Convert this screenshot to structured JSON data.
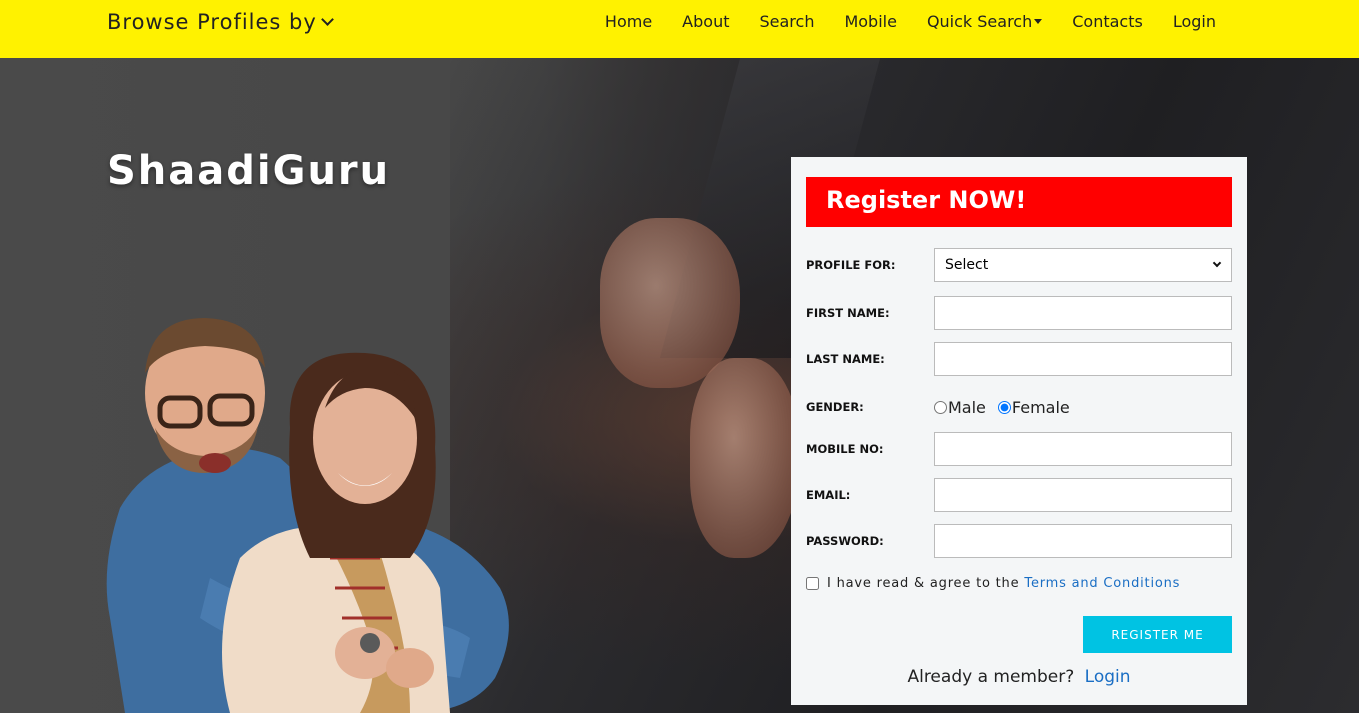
{
  "navbar": {
    "browse_label": "Browse Profiles by",
    "items": [
      {
        "label": "Home"
      },
      {
        "label": "About"
      },
      {
        "label": "Search"
      },
      {
        "label": "Mobile"
      },
      {
        "label": "Quick Search"
      },
      {
        "label": "Contacts"
      },
      {
        "label": "Login"
      }
    ]
  },
  "hero": {
    "brand": "ShaadiGuru"
  },
  "form": {
    "heading": "Register NOW!",
    "profile_for_label": "PROFILE FOR:",
    "profile_for_value": "Select",
    "first_name_label": "FIRST NAME:",
    "last_name_label": "LAST NAME:",
    "gender_label": "GENDER:",
    "gender_male": "Male",
    "gender_female": "Female",
    "gender_selected": "Female",
    "mobile_label": "MOBILE NO:",
    "email_label": "EMAIL:",
    "password_label": "PASSWORD:",
    "agree_text": "I have read & agree to the",
    "terms_link": "Terms and Conditions",
    "submit_label": "REGISTER ME",
    "already_text": "Already a member?",
    "login_link": "Login"
  },
  "colors": {
    "navbar_bg": "#fff200",
    "heading_bg": "#ff0000",
    "button_bg": "#00c3e3",
    "link": "#1a6ec4"
  }
}
